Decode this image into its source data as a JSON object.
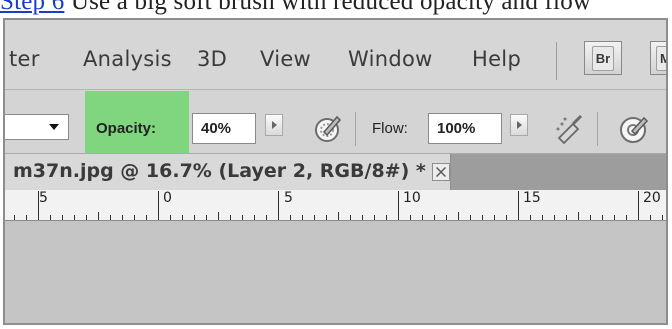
{
  "document": {
    "link_text": "Step 6",
    "caption_rest": " Use a big soft brush with reduced opacity and flow"
  },
  "menu": {
    "items": [
      "ter",
      "Analysis",
      "3D",
      "View",
      "Window",
      "Help"
    ],
    "bridge_button": "Br",
    "minibridge_button": "M"
  },
  "options": {
    "opacity_label": "Opacity:",
    "opacity_value": "40%",
    "flow_label": "Flow:",
    "flow_value": "100%"
  },
  "tab": {
    "title": "m37n.jpg @ 16.7% (Layer 2, RGB/8#) *"
  },
  "ruler": {
    "labels": [
      "5",
      "0",
      "5",
      "10",
      "15",
      "20"
    ]
  },
  "colors": {
    "highlight": "#7fd67f",
    "link": "#1a3cc8"
  },
  "icons": {
    "tablet_pressure_opacity": "pressure-pen-icon",
    "airbrush": "airbrush-icon",
    "tablet_pressure_size": "pressure-size-icon",
    "close": "close-icon",
    "dropdown": "chevron-down-icon",
    "stepper": "triangle-right-icon"
  }
}
